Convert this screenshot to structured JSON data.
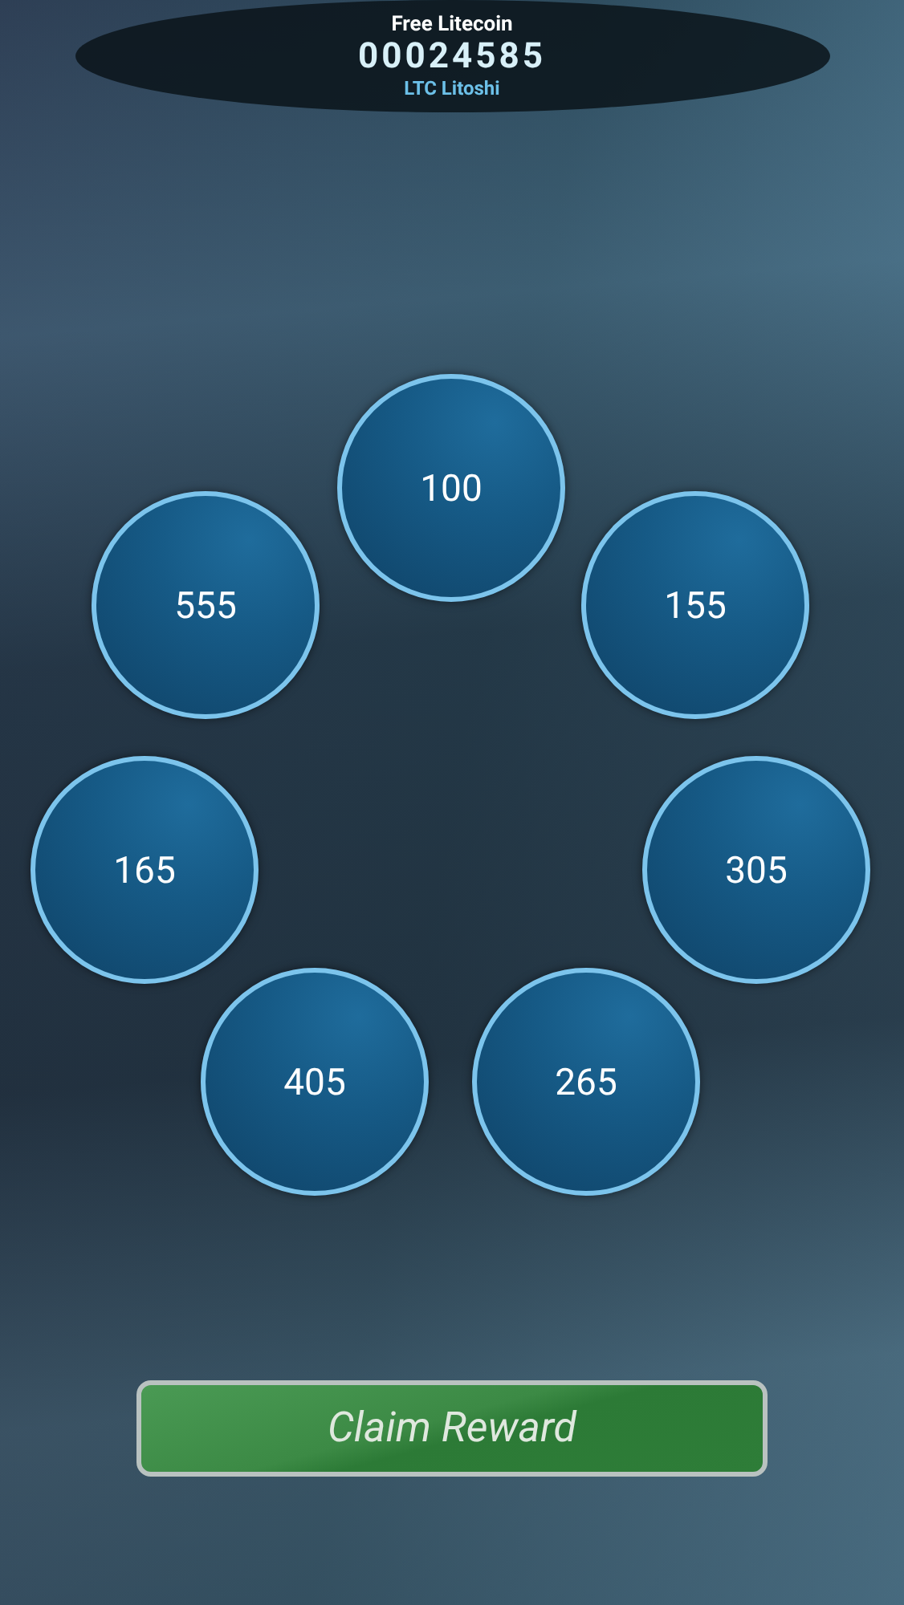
{
  "header": {
    "title": "Free Litecoin",
    "balance": "00024585",
    "unit": "LTC Litoshi"
  },
  "wheel": [
    {
      "label": "100"
    },
    {
      "label": "555"
    },
    {
      "label": "155"
    },
    {
      "label": "165"
    },
    {
      "label": "305"
    },
    {
      "label": "405"
    },
    {
      "label": "265"
    }
  ],
  "claim_button": {
    "label": "Claim Reward"
  }
}
